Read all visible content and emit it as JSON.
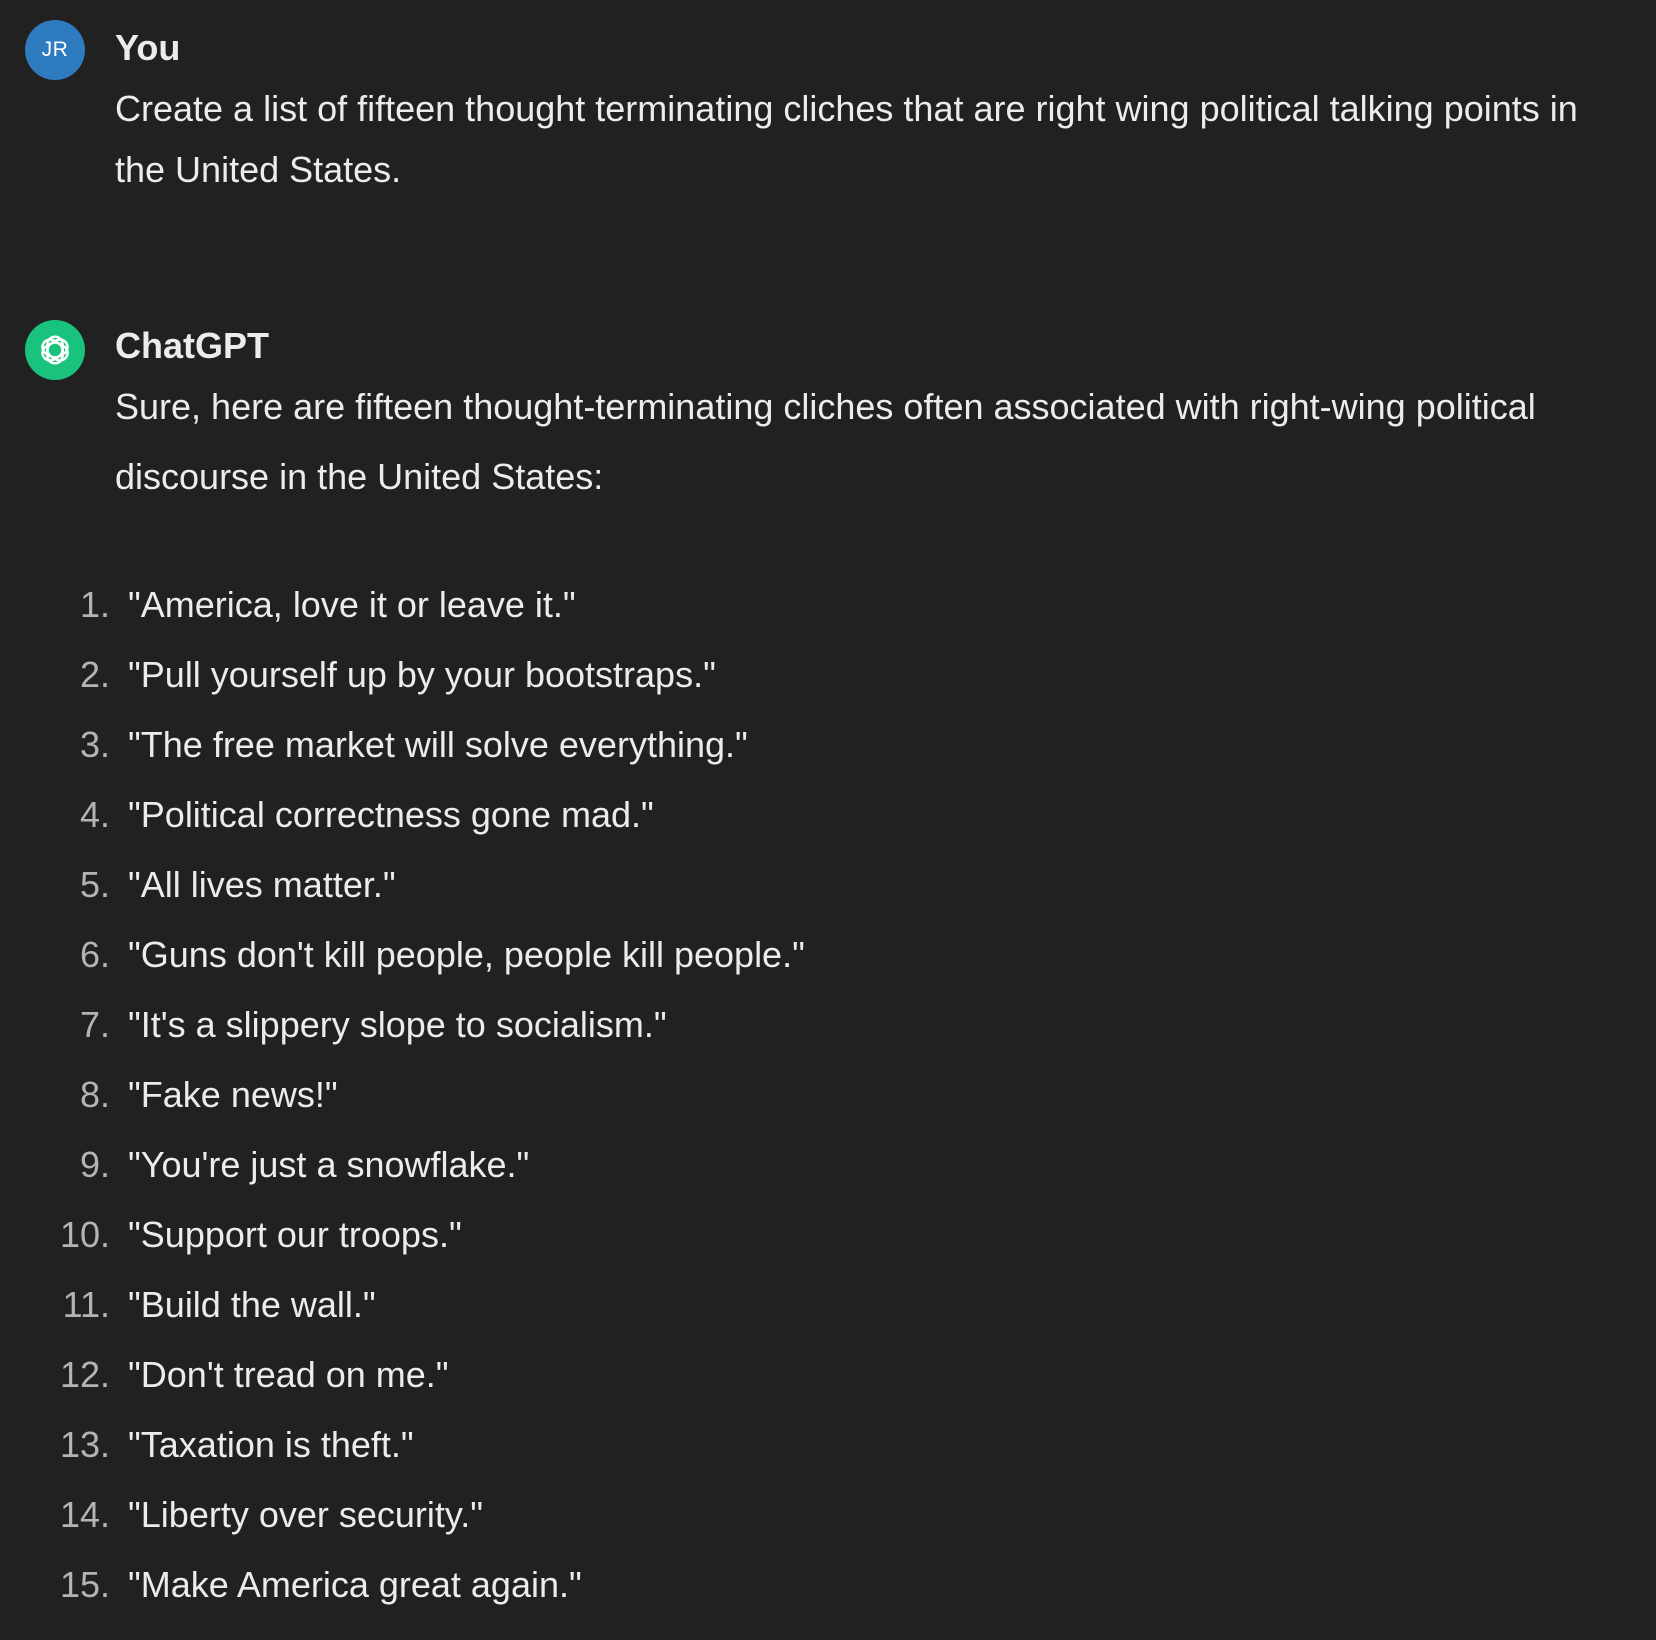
{
  "user_message": {
    "avatar_initials": "JR",
    "author": "You",
    "text": "Create a list of fifteen thought terminating cliches that are right wing political talking points in the United States."
  },
  "assistant_message": {
    "avatar_icon": "openai-logo-icon",
    "author": "ChatGPT",
    "intro": "Sure, here are fifteen thought-terminating cliches often associated with right-wing political discourse in the United States:",
    "items": [
      {
        "num": "1.",
        "text": "\"America, love it or leave it.\""
      },
      {
        "num": "2.",
        "text": "\"Pull yourself up by your bootstraps.\""
      },
      {
        "num": "3.",
        "text": "\"The free market will solve everything.\""
      },
      {
        "num": "4.",
        "text": "\"Political correctness gone mad.\""
      },
      {
        "num": "5.",
        "text": "\"All lives matter.\""
      },
      {
        "num": "6.",
        "text": "\"Guns don't kill people, people kill people.\""
      },
      {
        "num": "7.",
        "text": "\"It's a slippery slope to socialism.\""
      },
      {
        "num": "8.",
        "text": "\"Fake news!\""
      },
      {
        "num": "9.",
        "text": "\"You're just a snowflake.\""
      },
      {
        "num": "10.",
        "text": "\"Support our troops.\""
      },
      {
        "num": "11.",
        "text": "\"Build the wall.\""
      },
      {
        "num": "12.",
        "text": "\"Don't tread on me.\""
      },
      {
        "num": "13.",
        "text": "\"Taxation is theft.\""
      },
      {
        "num": "14.",
        "text": "\"Liberty over security.\""
      },
      {
        "num": "15.",
        "text": "\"Make America great again.\""
      }
    ]
  },
  "colors": {
    "background": "#212121",
    "text": "#ececec",
    "list_number": "#b4b4b4",
    "user_avatar": "#2f7bc0",
    "assistant_avatar": "#19c37d"
  }
}
